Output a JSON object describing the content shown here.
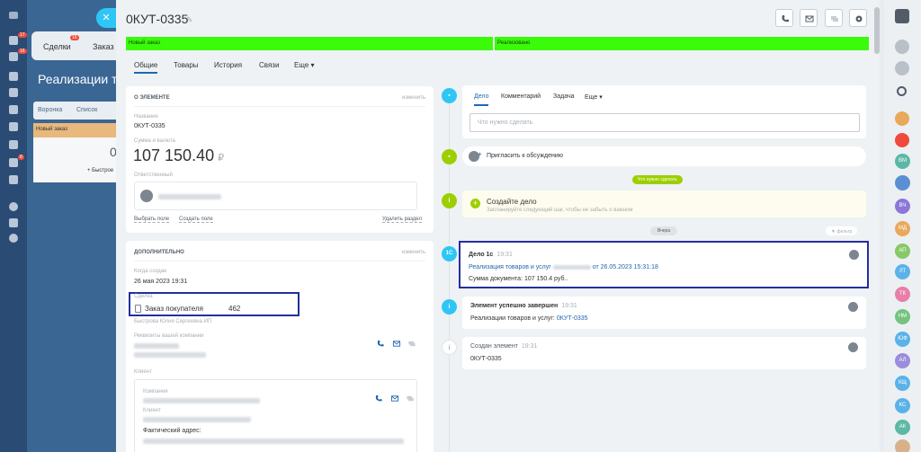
{
  "colors": {
    "accent": "#2067b0",
    "stage_green": "#39fb0a",
    "highlight": "#242e9e",
    "nav_bg": "#2a4b73",
    "timeline_blue": "#2fc6f6",
    "timeline_green": "#9dcf00"
  },
  "left_nav": {
    "badges": [
      "17",
      "16",
      "8"
    ]
  },
  "background_app": {
    "tabs": [
      "Сделки",
      "Заказ"
    ],
    "deals_badge": "16",
    "title": "Реализации то",
    "views": [
      "Воронка",
      "Список"
    ],
    "stage": "Новый заказ",
    "zero": "0",
    "quick": "+ Быстрое"
  },
  "header": {
    "title": "0КУТ-0335",
    "icons": [
      "phone-icon",
      "mail-icon",
      "chat-icon",
      "gear-icon"
    ]
  },
  "stages": [
    "Новый заказ",
    "Реализовано"
  ],
  "tabs": [
    "Общие",
    "Товары",
    "История",
    "Связи",
    "Еще ▾"
  ],
  "about": {
    "heading": "О ЭЛЕМЕНТЕ",
    "edit": "изменить",
    "name_label": "Название",
    "name": "0КУТ-0335",
    "sum_label": "Сумма и валюта",
    "sum": "107 150.40",
    "currency": "₽",
    "responsible_label": "Ответственный",
    "select_field": "Выбрать поле",
    "create_field": "Создать поле",
    "delete_section": "Удалить раздел"
  },
  "extra": {
    "heading": "ДОПОЛНИТЕЛЬНО",
    "edit": "изменить",
    "created_label": "Когда создан",
    "created": "26 мая 2023 19:31",
    "deal_label": "Сделка",
    "deal_name": "Заказ покупателя",
    "deal_number": "462",
    "deal_company": "Быстрова Юлия Сергеевна ИП",
    "company_details_label": "Реквизиты вашей компании",
    "client_label": "Клиент",
    "company_label": "Компания",
    "client_sub_label": "Клиент",
    "address_label": "Фактический адрес:"
  },
  "timeline": {
    "tabs": [
      "Дело",
      "Комментарий",
      "Задача",
      "Еще ▾"
    ],
    "input_placeholder": "Что нужно сделать",
    "invite": "Пригласить к обсуждению",
    "todo_pill": "Что нужно сделать",
    "create_title": "Создайте дело",
    "create_sub": "Запланируйте следующий шаг, чтобы не забыть о важном",
    "yesterday_pill": "Вчера",
    "filter": "фильтр",
    "entry1": {
      "badge": "1С",
      "title": "Дело 1с",
      "time": "19:31",
      "link_a": "Реализация товаров и услуг",
      "link_b": "от 26.05.2023 15:31:18",
      "text": "Сумма документа: 107 150.4 руб.."
    },
    "entry2": {
      "title": "Элемент успешно завершен",
      "time": "19:31",
      "text": "Реализации товаров и услуг:",
      "link": "0КУТ-0335"
    },
    "entry3": {
      "title": "Создан элемент",
      "time": "19:31",
      "text": "0КУТ-0335"
    }
  },
  "right_panel": {
    "avatars": [
      "ВМ",
      "ВЧ",
      "МД",
      "АП",
      "ЛТ",
      "ТК",
      "НМ",
      "ЮФ",
      "АЛ",
      "КЩ",
      "КС",
      "АК"
    ]
  }
}
